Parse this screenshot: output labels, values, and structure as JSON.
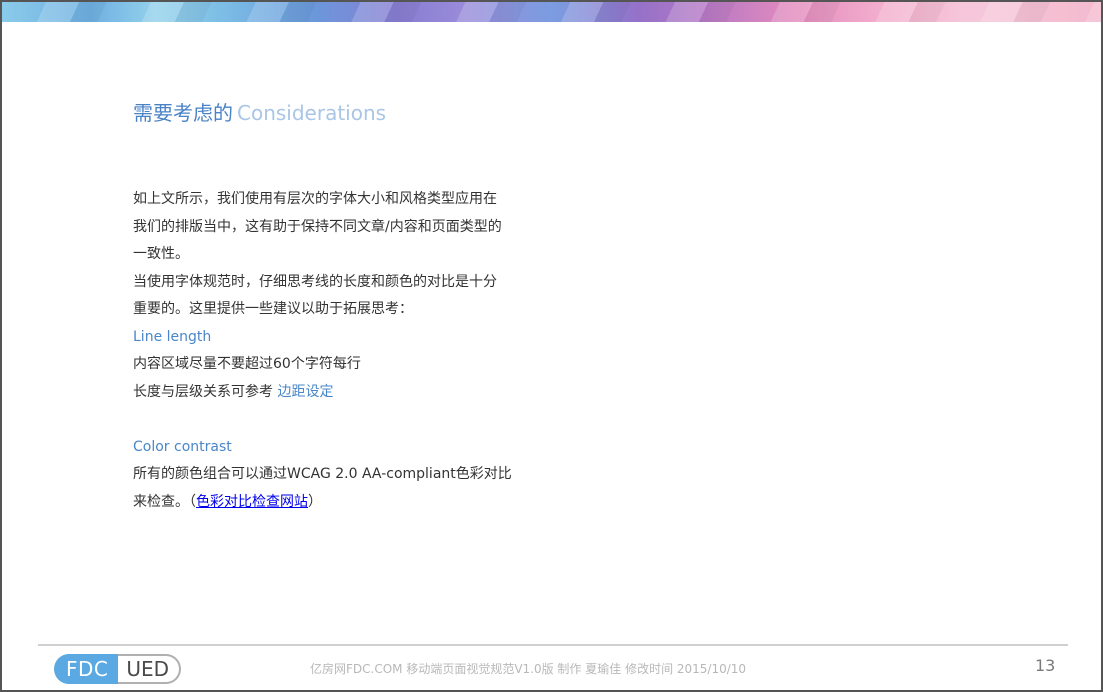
{
  "title": {
    "cn": "需要考虑的",
    "en": "Considerations"
  },
  "body": {
    "para1_line1": "如上文所示，我们使用有层次的字体大小和风格类型应用在",
    "para1_line2": "我们的排版当中，这有助于保持不同文章/内容和页面类型的",
    "para1_line3": "一致性。",
    "para2_line1": "当使用字体规范时，仔细思考线的长度和颜色的对比是十分",
    "para2_line2": "重要的。这里提供一些建议以助于拓展思考：",
    "line_length_heading": "Line length",
    "line_length_text": "内容区域尽量不要超过60个字符每行",
    "line_length_ref_prefix": "长度与层级关系可参考",
    "line_length_ref_link": "边距设定",
    "color_contrast_heading": "Color contrast",
    "color_contrast_line1": "所有的颜色组合可以通过WCAG 2.0 AA-compliant色彩对比",
    "color_contrast_line2_prefix": "来检查。（",
    "color_contrast_link": "色彩对比检查网站",
    "color_contrast_line2_suffix": "）"
  },
  "footer": {
    "logo_left": "FDC",
    "logo_right": "UED",
    "text": "亿房网FDC.COM 移动端页面视觉规范V1.0版  制作 夏瑜佳    修改时间  2015/10/10",
    "page_number": "13"
  },
  "colors": {
    "accent": "#4a82c6",
    "accent_light": "#a9c6e6",
    "link": "#0000ee",
    "text": "#333333"
  }
}
